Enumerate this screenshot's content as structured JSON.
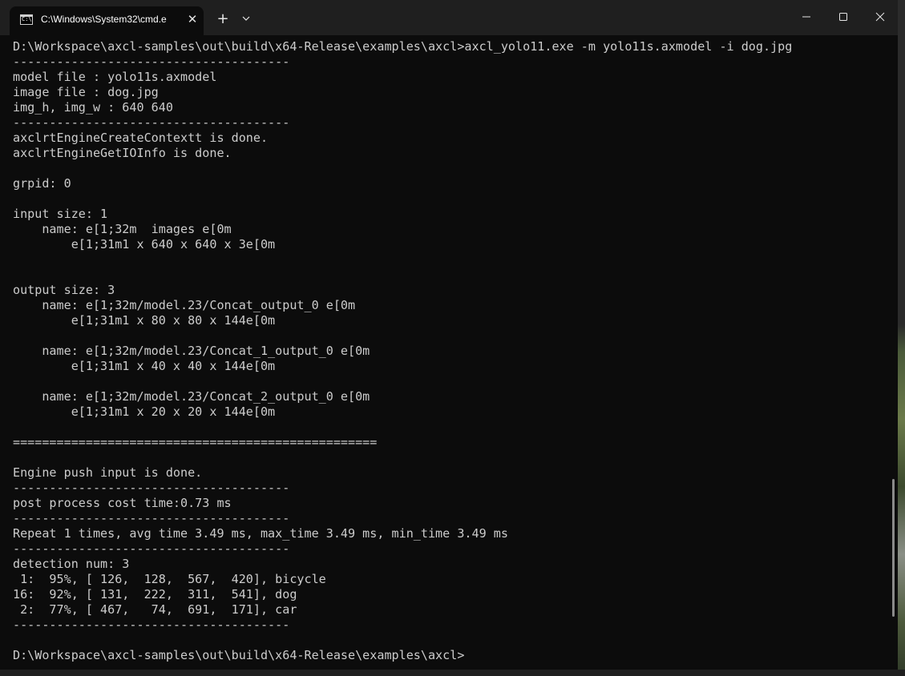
{
  "window": {
    "tab_title": "C:\\Windows\\System32\\cmd.e",
    "tab_icon_text": "C:\\",
    "close_tab_glyph": "✕",
    "new_tab_glyph": "+"
  },
  "terminal": {
    "lines": [
      "D:\\Workspace\\axcl-samples\\out\\build\\x64-Release\\examples\\axcl>axcl_yolo11.exe -m yolo11s.axmodel -i dog.jpg",
      "--------------------------------------",
      "model file : yolo11s.axmodel",
      "image file : dog.jpg",
      "img_h, img_w : 640 640",
      "--------------------------------------",
      "axclrtEngineCreateContextt is done.",
      "axclrtEngineGetIOInfo is done.",
      "",
      "grpid: 0",
      "",
      "input size: 1",
      "    name: e[1;32m  images e[0m",
      "        e[1;31m1 x 640 x 640 x 3e[0m",
      "",
      "",
      "output size: 3",
      "    name: e[1;32m/model.23/Concat_output_0 e[0m",
      "        e[1;31m1 x 80 x 80 x 144e[0m",
      "",
      "    name: e[1;32m/model.23/Concat_1_output_0 e[0m",
      "        e[1;31m1 x 40 x 40 x 144e[0m",
      "",
      "    name: e[1;32m/model.23/Concat_2_output_0 e[0m",
      "        e[1;31m1 x 20 x 20 x 144e[0m",
      "",
      "==================================================",
      "",
      "Engine push input is done.",
      "--------------------------------------",
      "post process cost time:0.73 ms",
      "--------------------------------------",
      "Repeat 1 times, avg time 3.49 ms, max_time 3.49 ms, min_time 3.49 ms",
      "--------------------------------------",
      "detection num: 3",
      " 1:  95%, [ 126,  128,  567,  420], bicycle",
      "16:  92%, [ 131,  222,  311,  541], dog",
      " 2:  77%, [ 467,   74,  691,  171], car",
      "--------------------------------------",
      "",
      "D:\\Workspace\\axcl-samples\\out\\build\\x64-Release\\examples\\axcl>"
    ]
  },
  "colors": {
    "terminal_bg": "#0c0c0c",
    "terminal_fg": "#cccccc",
    "titlebar_bg": "#1f1f1f"
  }
}
